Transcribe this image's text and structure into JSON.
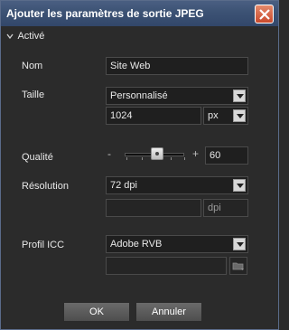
{
  "window": {
    "title": "Ajouter les paramètres de sortie JPEG"
  },
  "section": {
    "label": "Activé"
  },
  "nom": {
    "label": "Nom",
    "value": "Site Web"
  },
  "taille": {
    "label": "Taille",
    "preset": "Personnalisé",
    "value": "1024",
    "unit": "px"
  },
  "qualite": {
    "label": "Qualité",
    "minus": "-",
    "plus": "+",
    "value": "60",
    "level": 60
  },
  "resolution": {
    "label": "Résolution",
    "preset": "72 dpi",
    "value": "",
    "unit": "dpi"
  },
  "icc": {
    "label": "Profil ICC",
    "preset": "Adobe RVB",
    "path": ""
  },
  "buttons": {
    "ok": "OK",
    "cancel": "Annuler"
  },
  "icons": {
    "close": "close-icon",
    "collapse": "chevron-down-icon",
    "folder": "folder-icon"
  }
}
